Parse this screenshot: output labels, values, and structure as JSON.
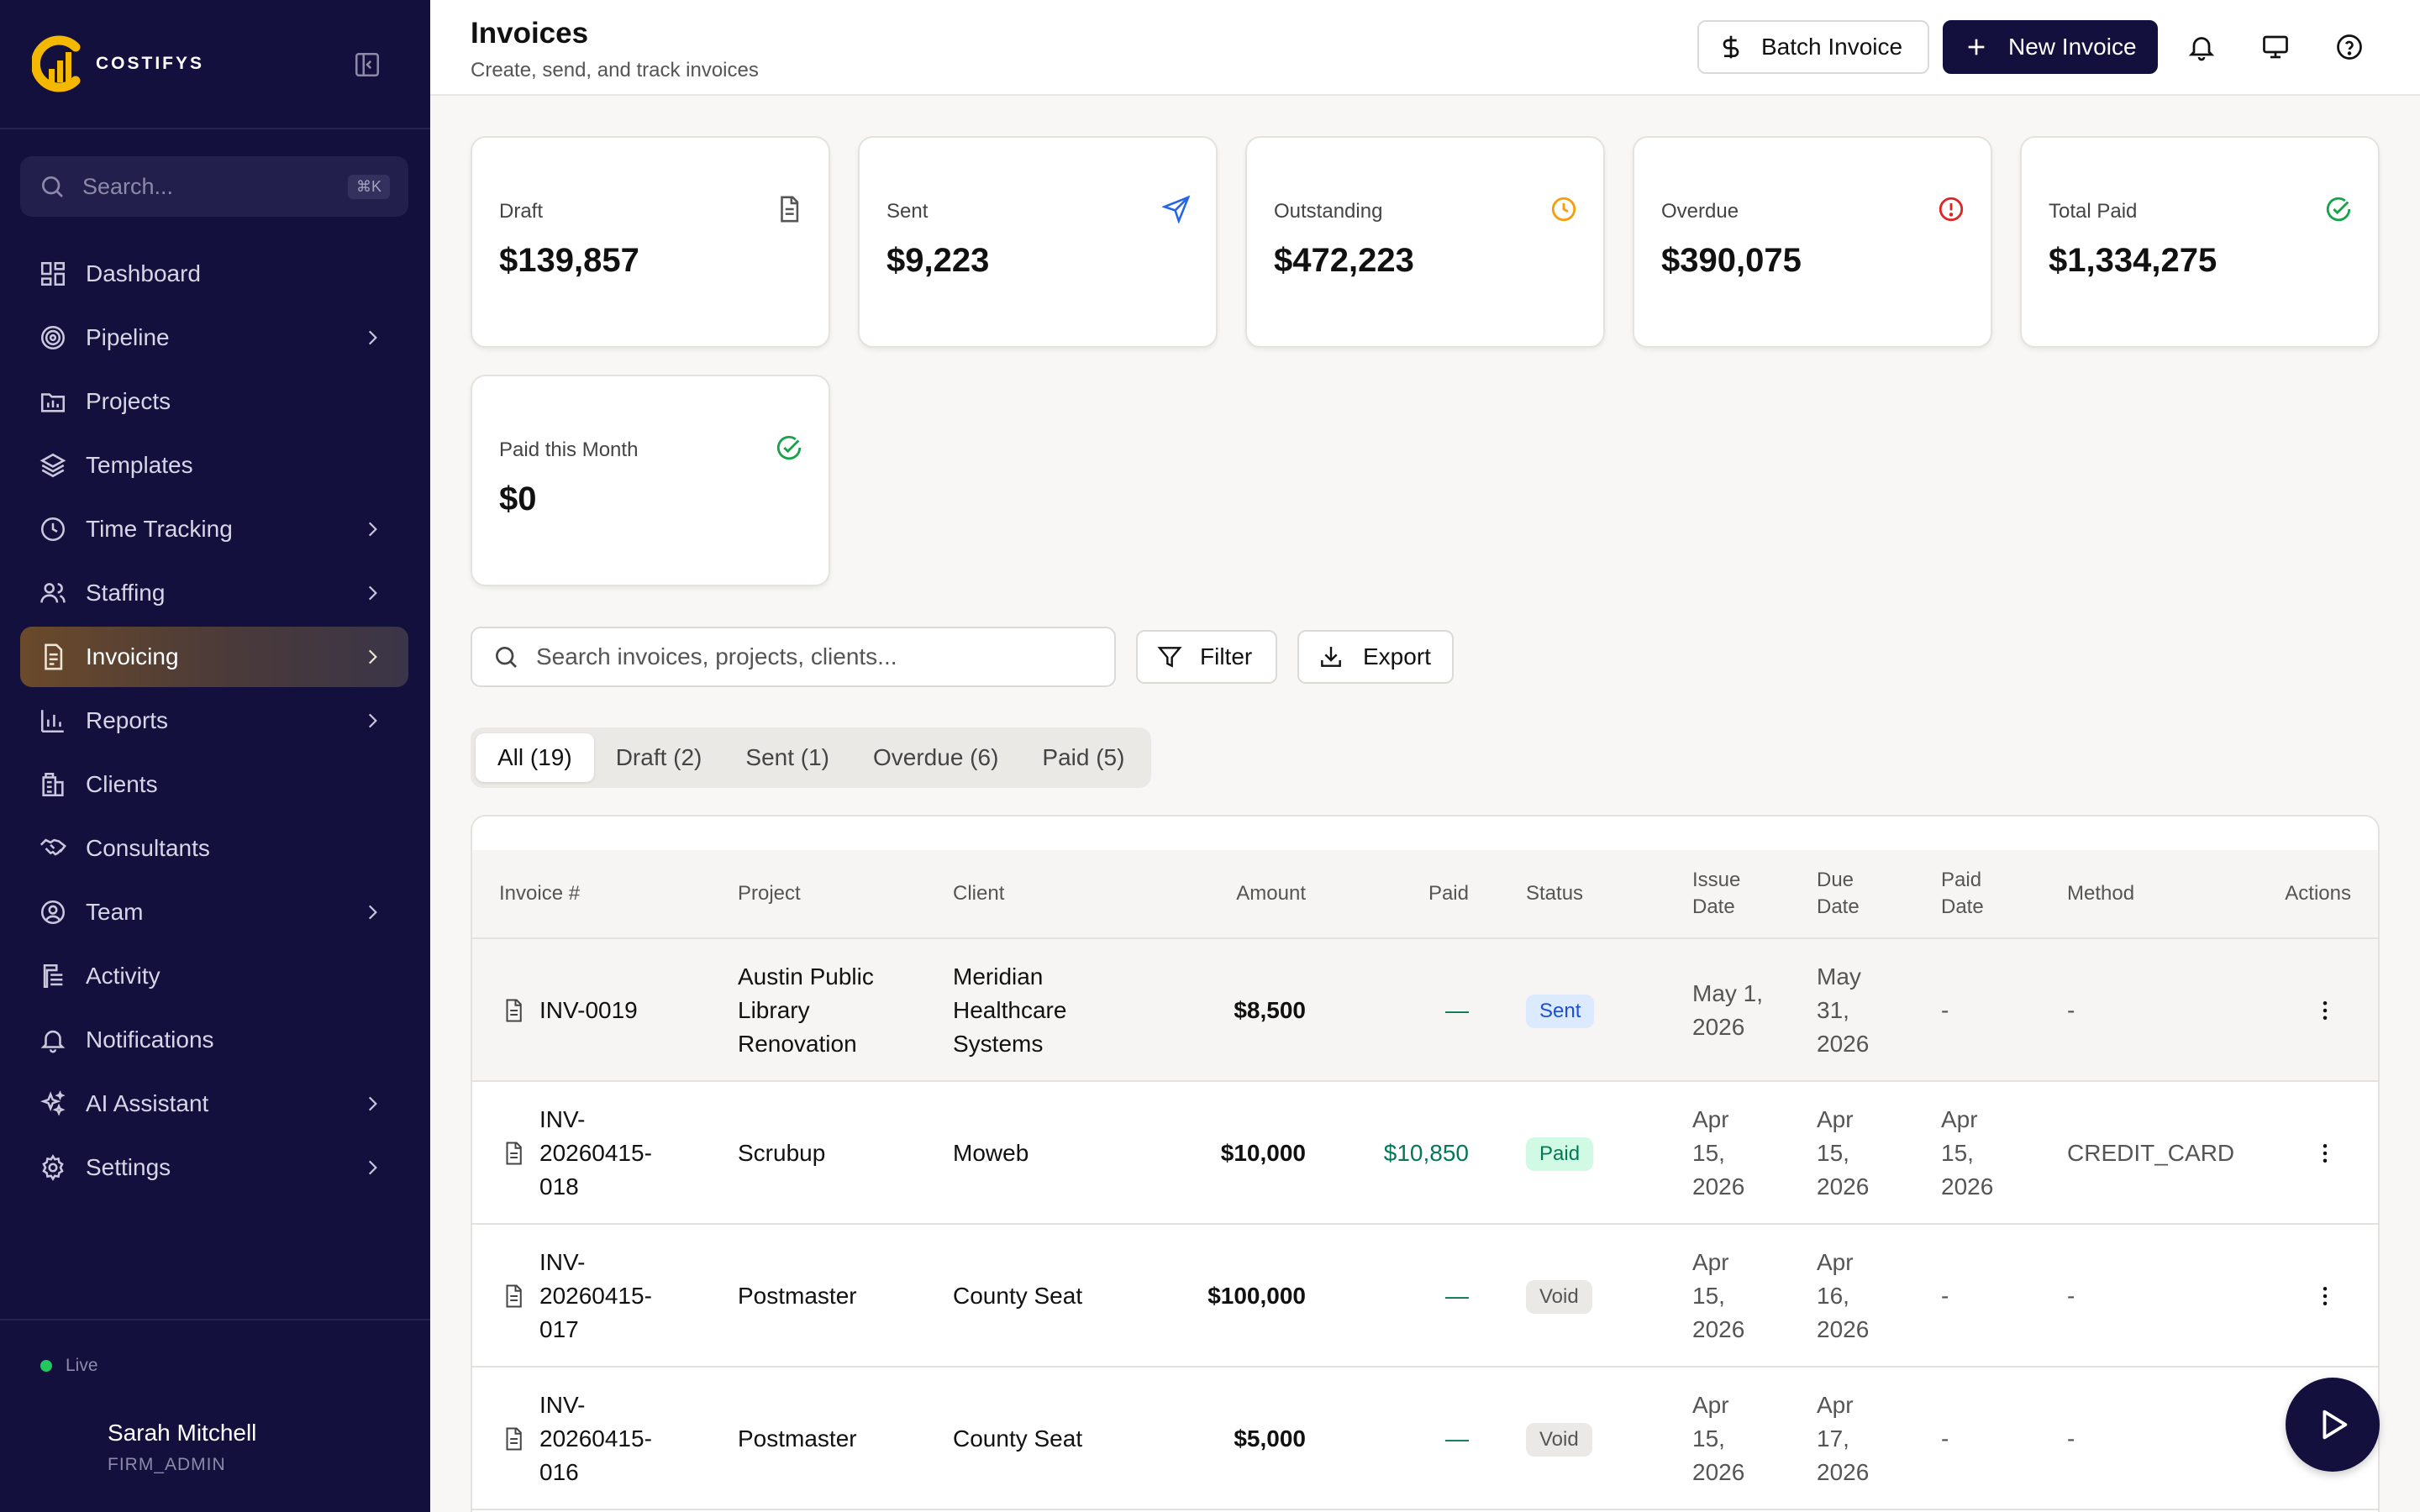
{
  "brand": {
    "name": "COSTIFYS",
    "accent": "#f5b800"
  },
  "sidebar": {
    "search_placeholder": "Search...",
    "search_shortcut": "⌘K",
    "items": [
      {
        "label": "Dashboard",
        "icon": "dashboard-icon",
        "chevron": false
      },
      {
        "label": "Pipeline",
        "icon": "target-icon",
        "chevron": true
      },
      {
        "label": "Projects",
        "icon": "folder-chart-icon",
        "chevron": false
      },
      {
        "label": "Templates",
        "icon": "layers-icon",
        "chevron": false
      },
      {
        "label": "Time Tracking",
        "icon": "clock-icon",
        "chevron": true
      },
      {
        "label": "Staffing",
        "icon": "users-icon",
        "chevron": true
      },
      {
        "label": "Invoicing",
        "icon": "invoice-icon",
        "chevron": true,
        "active": true
      },
      {
        "label": "Reports",
        "icon": "bar-chart-icon",
        "chevron": true
      },
      {
        "label": "Clients",
        "icon": "building-icon",
        "chevron": false
      },
      {
        "label": "Consultants",
        "icon": "handshake-icon",
        "chevron": false
      },
      {
        "label": "Team",
        "icon": "user-circle-icon",
        "chevron": true
      },
      {
        "label": "Activity",
        "icon": "activity-icon",
        "chevron": false
      },
      {
        "label": "Notifications",
        "icon": "bell-icon",
        "chevron": false
      },
      {
        "label": "AI Assistant",
        "icon": "sparkles-icon",
        "chevron": true
      },
      {
        "label": "Settings",
        "icon": "gear-icon",
        "chevron": true
      }
    ],
    "status": "Live",
    "user": {
      "name": "Sarah Mitchell",
      "role": "FIRM_ADMIN"
    }
  },
  "header": {
    "title": "Invoices",
    "subtitle": "Create, send, and track invoices",
    "batch_label": "Batch Invoice",
    "new_label": "New Invoice"
  },
  "stats": [
    {
      "label": "Draft",
      "value": "$139,857",
      "icon": "document-icon",
      "color": "#555555"
    },
    {
      "label": "Sent",
      "value": "$9,223",
      "icon": "send-icon",
      "color": "#2563eb"
    },
    {
      "label": "Outstanding",
      "value": "$472,223",
      "icon": "clock-icon",
      "color": "#f59e0b"
    },
    {
      "label": "Overdue",
      "value": "$390,075",
      "icon": "alert-circle-icon",
      "color": "#dc2626"
    },
    {
      "label": "Total Paid",
      "value": "$1,334,275",
      "icon": "check-circle-icon",
      "color": "#16a34a"
    },
    {
      "label": "Paid this Month",
      "value": "$0",
      "icon": "check-circle-icon",
      "color": "#16a34a"
    }
  ],
  "toolbar": {
    "search_placeholder": "Search invoices, projects, clients...",
    "filter_label": "Filter",
    "export_label": "Export"
  },
  "tabs": [
    {
      "label": "All (19)",
      "active": true
    },
    {
      "label": "Draft (2)"
    },
    {
      "label": "Sent (1)"
    },
    {
      "label": "Overdue (6)"
    },
    {
      "label": "Paid (5)"
    }
  ],
  "table": {
    "columns": {
      "invoice": "Invoice #",
      "project": "Project",
      "client": "Client",
      "amount": "Amount",
      "paid": "Paid",
      "status": "Status",
      "issue1": "Issue",
      "issue2": "Date",
      "due1": "Due",
      "due2": "Date",
      "paiddate1": "Paid",
      "paiddate2": "Date",
      "method": "Method",
      "actions": "Actions"
    },
    "rows": [
      {
        "invoice": [
          "INV-0019"
        ],
        "project": [
          "Austin Public",
          "Library",
          "Renovation"
        ],
        "client": [
          "Meridian",
          "Healthcare",
          "Systems"
        ],
        "amount": "$8,500",
        "paid": "—",
        "status": "Sent",
        "issue": [
          "May 1,",
          "2026"
        ],
        "due": [
          "May",
          "31,",
          "2026"
        ],
        "paid_date": [
          "-"
        ],
        "method": "-"
      },
      {
        "invoice": [
          "INV-",
          "20260415-",
          "018"
        ],
        "project": [
          "Scrubup"
        ],
        "client": [
          "Moweb"
        ],
        "amount": "$10,000",
        "paid": "$10,850",
        "status": "Paid",
        "issue": [
          "Apr",
          "15,",
          "2026"
        ],
        "due": [
          "Apr",
          "15,",
          "2026"
        ],
        "paid_date": [
          "Apr",
          "15,",
          "2026"
        ],
        "method": "CREDIT_CARD"
      },
      {
        "invoice": [
          "INV-",
          "20260415-",
          "017"
        ],
        "project": [
          "Postmaster"
        ],
        "client": [
          "County Seat"
        ],
        "amount": "$100,000",
        "paid": "—",
        "status": "Void",
        "issue": [
          "Apr",
          "15,",
          "2026"
        ],
        "due": [
          "Apr",
          "16,",
          "2026"
        ],
        "paid_date": [
          "-"
        ],
        "method": "-"
      },
      {
        "invoice": [
          "INV-",
          "20260415-",
          "016"
        ],
        "project": [
          "Postmaster"
        ],
        "client": [
          "County Seat"
        ],
        "amount": "$5,000",
        "paid": "—",
        "status": "Void",
        "issue": [
          "Apr",
          "15,",
          "2026"
        ],
        "due": [
          "Apr",
          "17,",
          "2026"
        ],
        "paid_date": [
          "-"
        ],
        "method": "-"
      }
    ]
  }
}
